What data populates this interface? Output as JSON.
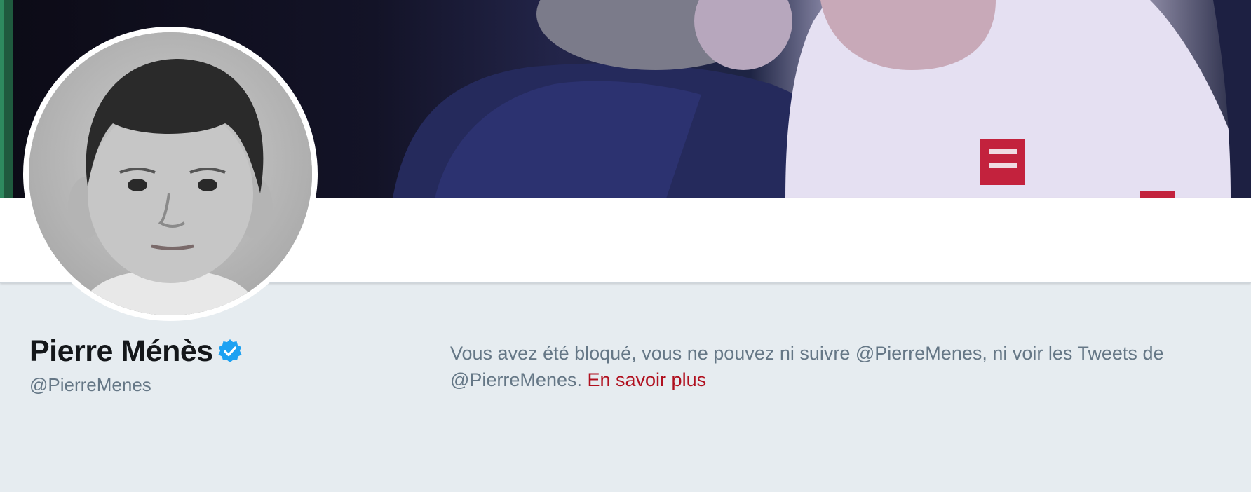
{
  "profile": {
    "name": "Pierre Ménès",
    "handle": "@PierreMenes",
    "verified": true,
    "verified_color": "#1da1f2"
  },
  "blocked_notice": {
    "message": "Vous avez été bloqué, vous ne pouvez ni suivre @PierreMenes, ni voir les Tweets de @PierreMenes.",
    "link_label": "En savoir plus",
    "link_color": "#b0101f"
  },
  "icons": {
    "verified_badge": "verified-badge-icon"
  }
}
